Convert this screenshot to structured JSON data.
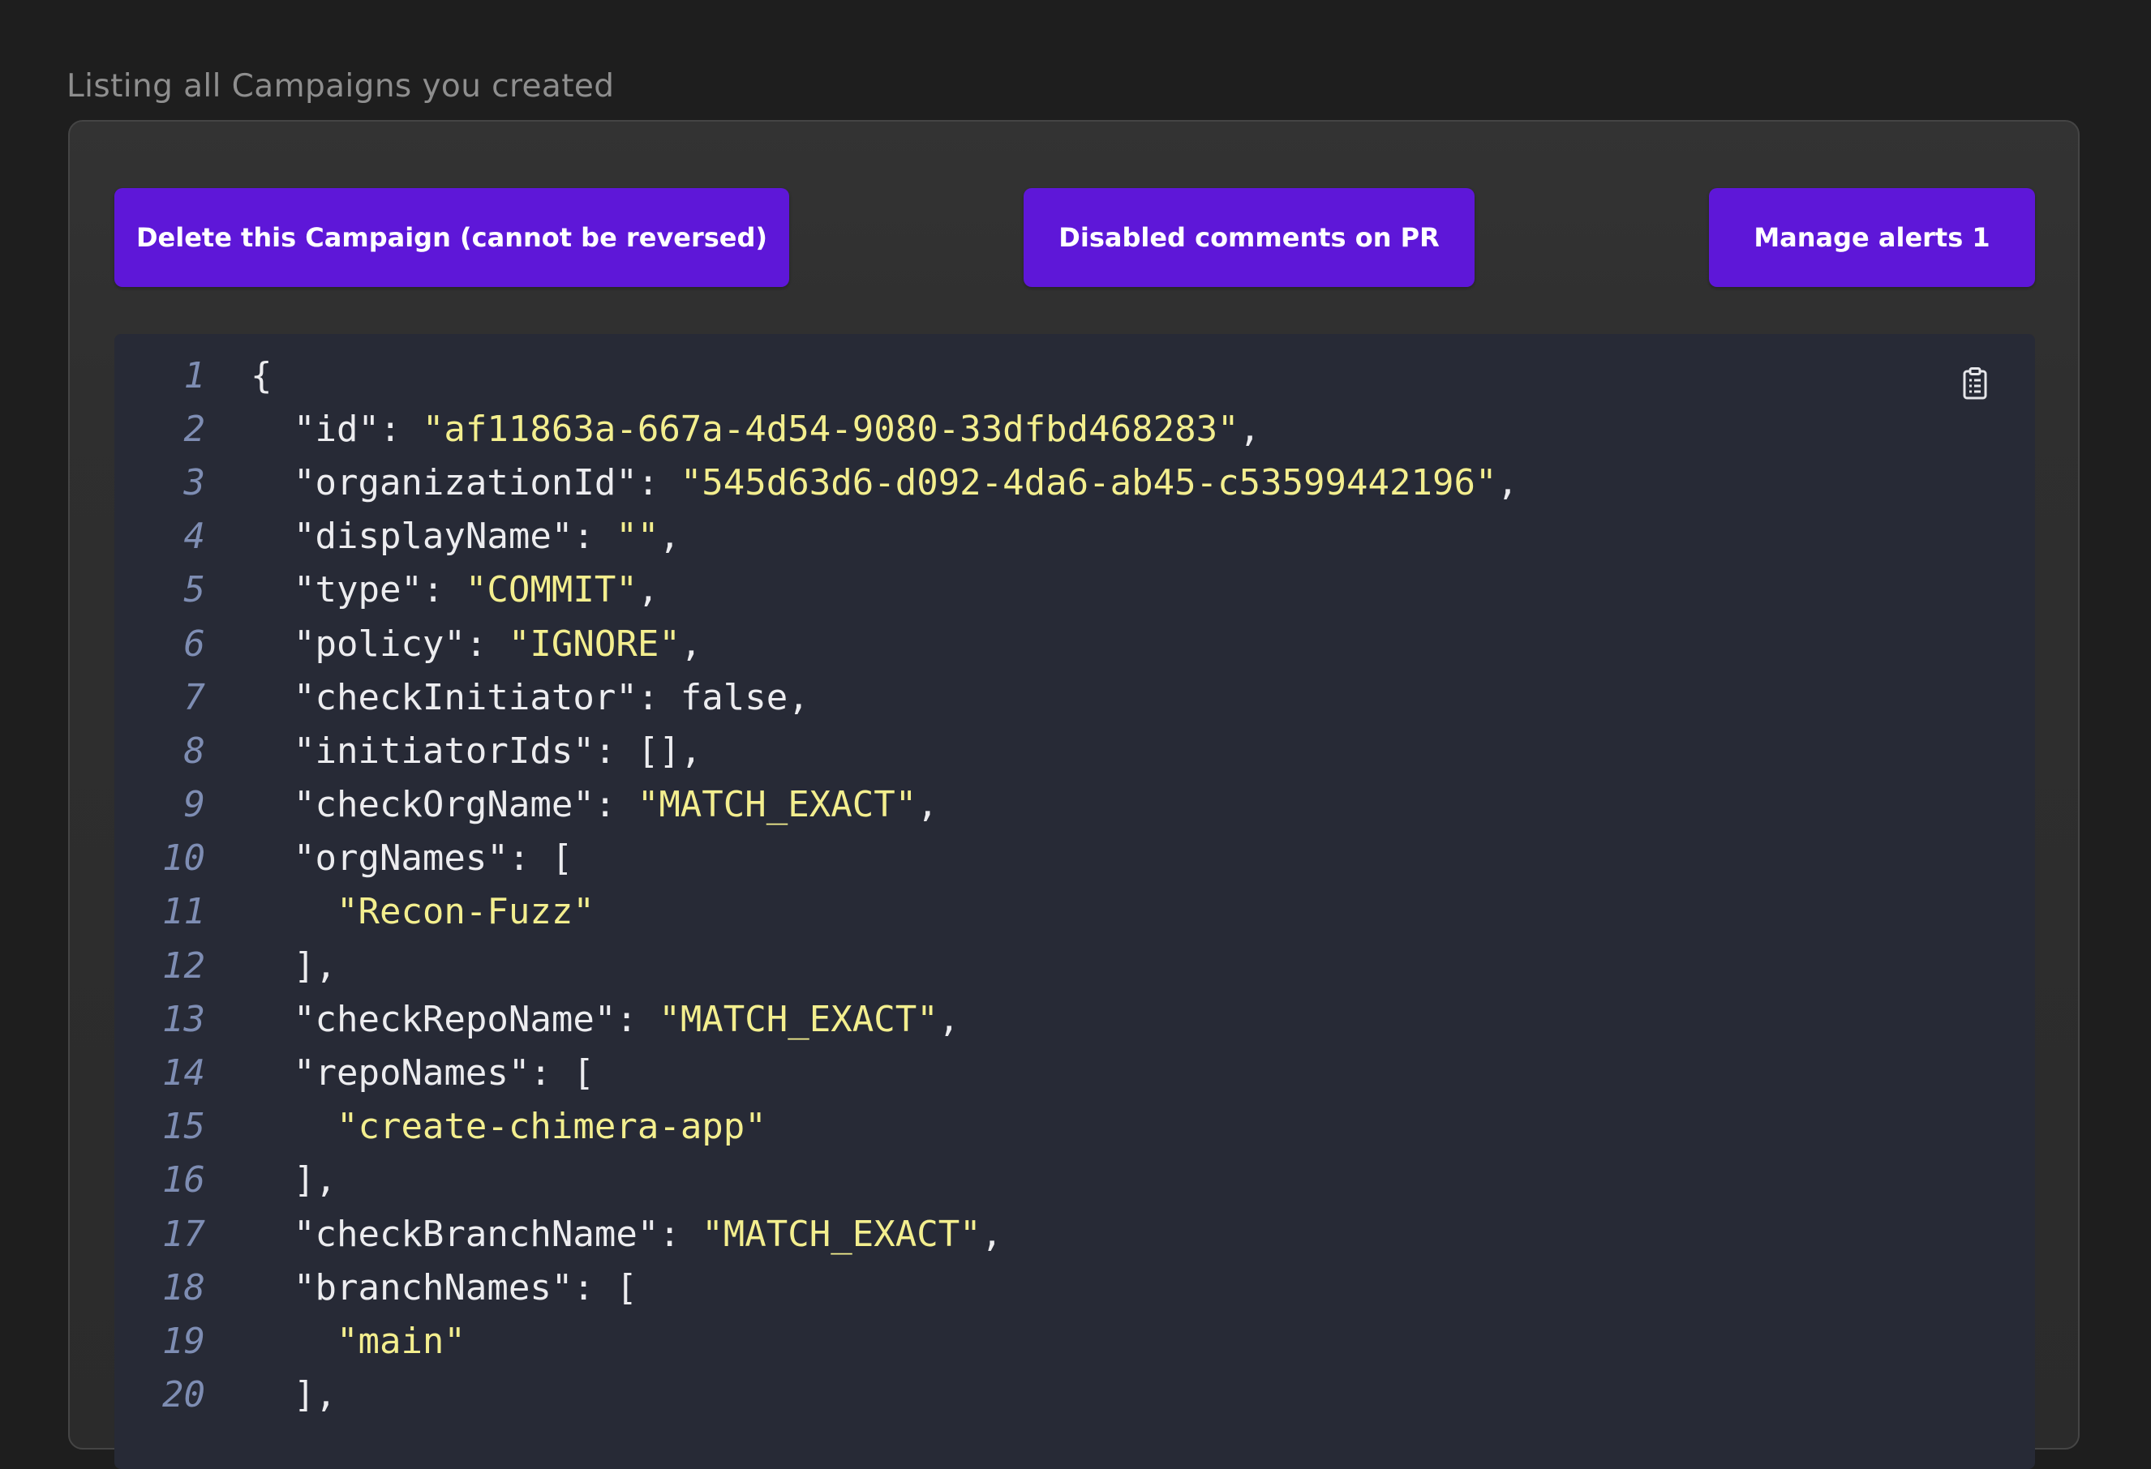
{
  "page": {
    "label": "Listing all Campaigns you created"
  },
  "toolbar": {
    "delete_label": "Delete this Campaign (cannot be reversed)",
    "comments_label": "Disabled comments on PR",
    "alerts_label": "Manage alerts 1"
  },
  "code": {
    "copy_icon": "clipboard-icon",
    "lines": [
      {
        "n": "1",
        "parts": [
          {
            "t": "{",
            "c": "p"
          }
        ]
      },
      {
        "n": "2",
        "parts": [
          {
            "t": "  \"id\": ",
            "c": "p"
          },
          {
            "t": "\"af11863a-667a-4d54-9080-33dfbd468283\"",
            "c": "s"
          },
          {
            "t": ",",
            "c": "p"
          }
        ]
      },
      {
        "n": "3",
        "parts": [
          {
            "t": "  \"organizationId\": ",
            "c": "p"
          },
          {
            "t": "\"545d63d6-d092-4da6-ab45-c53599442196\"",
            "c": "s"
          },
          {
            "t": ",",
            "c": "p"
          }
        ]
      },
      {
        "n": "4",
        "parts": [
          {
            "t": "  \"displayName\": ",
            "c": "p"
          },
          {
            "t": "\"\"",
            "c": "s"
          },
          {
            "t": ",",
            "c": "p"
          }
        ]
      },
      {
        "n": "5",
        "parts": [
          {
            "t": "  \"type\": ",
            "c": "p"
          },
          {
            "t": "\"COMMIT\"",
            "c": "s"
          },
          {
            "t": ",",
            "c": "p"
          }
        ]
      },
      {
        "n": "6",
        "parts": [
          {
            "t": "  \"policy\": ",
            "c": "p"
          },
          {
            "t": "\"IGNORE\"",
            "c": "s"
          },
          {
            "t": ",",
            "c": "p"
          }
        ]
      },
      {
        "n": "7",
        "parts": [
          {
            "t": "  \"checkInitiator\": false,",
            "c": "p"
          }
        ]
      },
      {
        "n": "8",
        "parts": [
          {
            "t": "  \"initiatorIds\": [],",
            "c": "p"
          }
        ]
      },
      {
        "n": "9",
        "parts": [
          {
            "t": "  \"checkOrgName\": ",
            "c": "p"
          },
          {
            "t": "\"MATCH_EXACT\"",
            "c": "s"
          },
          {
            "t": ",",
            "c": "p"
          }
        ]
      },
      {
        "n": "10",
        "parts": [
          {
            "t": "  \"orgNames\": [",
            "c": "p"
          }
        ]
      },
      {
        "n": "11",
        "parts": [
          {
            "t": "    ",
            "c": "p"
          },
          {
            "t": "\"Recon-Fuzz\"",
            "c": "s"
          }
        ]
      },
      {
        "n": "12",
        "parts": [
          {
            "t": "  ],",
            "c": "p"
          }
        ]
      },
      {
        "n": "13",
        "parts": [
          {
            "t": "  \"checkRepoName\": ",
            "c": "p"
          },
          {
            "t": "\"MATCH_EXACT\"",
            "c": "s"
          },
          {
            "t": ",",
            "c": "p"
          }
        ]
      },
      {
        "n": "14",
        "parts": [
          {
            "t": "  \"repoNames\": [",
            "c": "p"
          }
        ]
      },
      {
        "n": "15",
        "parts": [
          {
            "t": "    ",
            "c": "p"
          },
          {
            "t": "\"create-chimera-app\"",
            "c": "s"
          }
        ]
      },
      {
        "n": "16",
        "parts": [
          {
            "t": "  ],",
            "c": "p"
          }
        ]
      },
      {
        "n": "17",
        "parts": [
          {
            "t": "  \"checkBranchName\": ",
            "c": "p"
          },
          {
            "t": "\"MATCH_EXACT\"",
            "c": "s"
          },
          {
            "t": ",",
            "c": "p"
          }
        ]
      },
      {
        "n": "18",
        "parts": [
          {
            "t": "  \"branchNames\": [",
            "c": "p"
          }
        ]
      },
      {
        "n": "19",
        "parts": [
          {
            "t": "    ",
            "c": "p"
          },
          {
            "t": "\"main\"",
            "c": "s"
          }
        ]
      },
      {
        "n": "20",
        "parts": [
          {
            "t": "  ],",
            "c": "p"
          }
        ]
      }
    ]
  },
  "colors": {
    "accent": "#5e17d8",
    "string": "#f3ee8e",
    "line_number": "#7e8db3",
    "code_bg": "#272a36"
  }
}
